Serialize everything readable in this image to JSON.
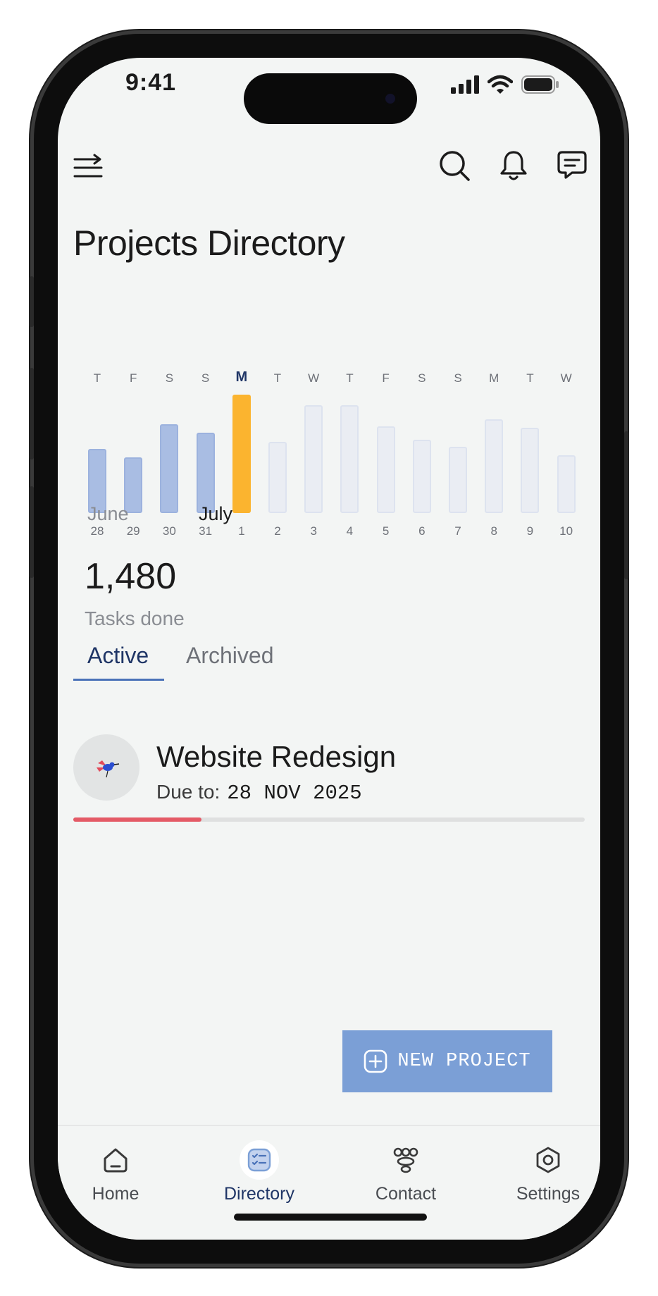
{
  "status_bar": {
    "time": "9:41"
  },
  "page": {
    "title": "Projects Directory"
  },
  "chart_data": {
    "type": "bar",
    "days": [
      "T",
      "F",
      "S",
      "S",
      "M",
      "T",
      "W",
      "T",
      "F",
      "S",
      "S",
      "M",
      "T",
      "W"
    ],
    "categories": [
      "28",
      "29",
      "30",
      "31",
      "1",
      "2",
      "3",
      "4",
      "5",
      "6",
      "7",
      "8",
      "9",
      "10"
    ],
    "values": [
      0.54,
      0.47,
      0.75,
      0.68,
      1.0,
      0.6,
      0.91,
      0.91,
      0.73,
      0.62,
      0.56,
      0.79,
      0.72,
      0.49
    ],
    "active_index": 4,
    "states": [
      "past",
      "past",
      "past",
      "past",
      "today",
      "future",
      "future",
      "future",
      "future",
      "future",
      "future",
      "future",
      "future",
      "future"
    ],
    "colors": {
      "past": "#a9bde3",
      "today": "#fbb42f",
      "future": "#eaedf3"
    },
    "months": [
      "June",
      "July"
    ]
  },
  "stats": {
    "value": "1,480",
    "label": "Tasks done"
  },
  "tabs": [
    {
      "label": "Active",
      "active": true
    },
    {
      "label": "Archived",
      "active": false
    }
  ],
  "project": {
    "name": "Website Redesign",
    "due_label": "Due to:",
    "due_date": "28 NOV 2025",
    "progress": 0.25
  },
  "new_project_button": {
    "label": "NEW PROJECT"
  },
  "bottom_nav": [
    {
      "label": "Home",
      "icon": "home-icon",
      "active": false
    },
    {
      "label": "Directory",
      "icon": "directory-icon",
      "active": true
    },
    {
      "label": "Contact",
      "icon": "contact-icon",
      "active": false
    },
    {
      "label": "Settings",
      "icon": "settings-icon",
      "active": false
    }
  ],
  "colors": {
    "accent": "#1f3566",
    "primary_button": "#7b9fd6",
    "progress": "#e45a66"
  }
}
